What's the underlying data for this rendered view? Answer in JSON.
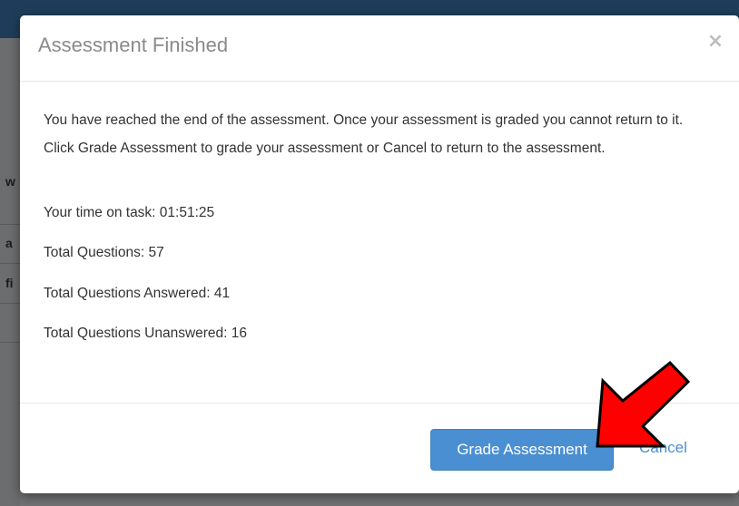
{
  "background": {
    "sliver_texts": [
      "w",
      "a",
      "fi"
    ]
  },
  "modal": {
    "title": "Assessment Finished",
    "close_symbol": "×",
    "message": "You have reached the end of the assessment. Once your assessment is graded you cannot return to it. Click Grade Assessment to grade your assessment or Cancel to return to the assessment.",
    "time_on_task": "Your time on task: 01:51:25",
    "total_questions": "Total Questions: 57",
    "total_answered": "Total Questions Answered: 41",
    "total_unanswered": "Total Questions Unanswered: 16",
    "grade_button_label": "Grade Assessment",
    "cancel_label": "Cancel"
  },
  "annotation": {
    "arrow_icon": "red-arrow-icon",
    "arrow_color": "#ff0000"
  },
  "colors": {
    "primary": "#4a8fd1",
    "header_bar": "#1f3d5a"
  }
}
